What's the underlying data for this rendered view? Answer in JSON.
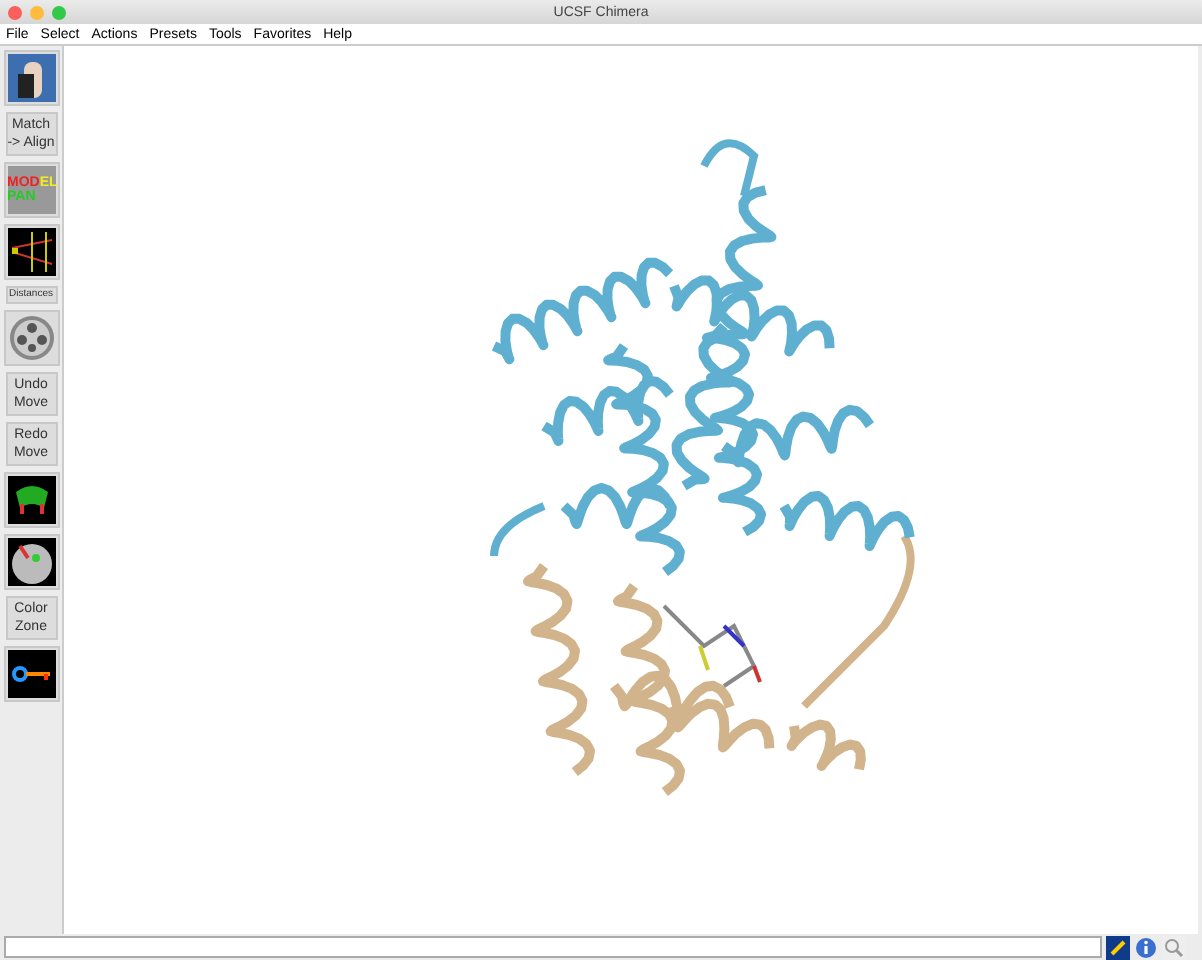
{
  "window": {
    "title": "UCSF Chimera"
  },
  "menu": [
    "File",
    "Select",
    "Actions",
    "Presets",
    "Tools",
    "Favorites",
    "Help"
  ],
  "toolbar": [
    {
      "kind": "photo"
    },
    {
      "kind": "text",
      "lines": [
        "Match",
        "-> Align"
      ]
    },
    {
      "kind": "panel",
      "letters": [
        "MOD",
        "EL",
        "PAN"
      ]
    },
    {
      "kind": "distances"
    },
    {
      "kind": "caption",
      "label": "Distances"
    },
    {
      "kind": "reel"
    },
    {
      "kind": "text",
      "lines": [
        "Undo",
        "Move"
      ]
    },
    {
      "kind": "text",
      "lines": [
        "Redo",
        "Move"
      ]
    },
    {
      "kind": "surface"
    },
    {
      "kind": "sphere"
    },
    {
      "kind": "text",
      "lines": [
        "Color",
        "Zone"
      ]
    },
    {
      "kind": "key"
    }
  ]
}
